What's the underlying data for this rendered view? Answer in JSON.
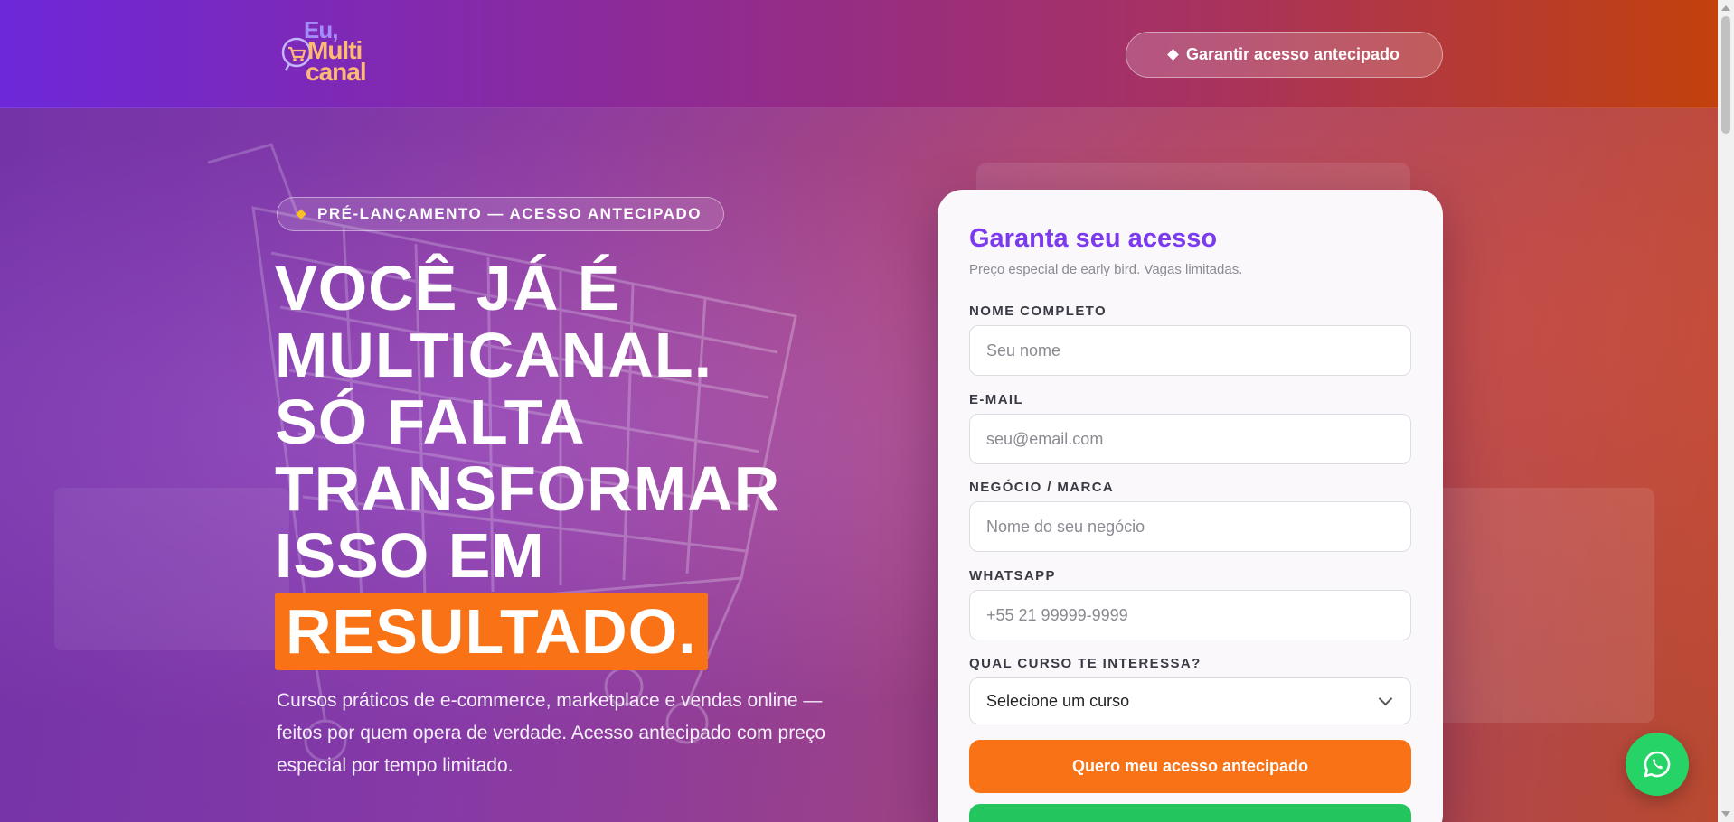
{
  "header": {
    "logo": {
      "line1": "Eu,",
      "line2": "Multi",
      "line3": "canal"
    },
    "cta_label": "Garantir acesso antecipado"
  },
  "hero": {
    "badge": "PRÉ-LANÇAMENTO — ACESSO ANTECIPADO",
    "headline_lines": [
      "VOCÊ JÁ É",
      "MULTICANAL.",
      "SÓ FALTA",
      "TRANSFORMAR",
      "ISSO EM"
    ],
    "headline_highlight": "RESULTADO.",
    "subtext": "Cursos práticos de e-commerce, marketplace e vendas online — feitos por quem opera de verdade. Acesso antecipado com preço especial por tempo limitado."
  },
  "form": {
    "title": "Garanta seu acesso",
    "subtitle": "Preço especial de early bird. Vagas limitadas.",
    "name_label": "NOME COMPLETO",
    "name_placeholder": "Seu nome",
    "email_label": "E-MAIL",
    "email_placeholder": "seu@email.com",
    "business_label": "NEGÓCIO / MARCA",
    "business_placeholder": "Nome do seu negócio",
    "whatsapp_label": "WHATSAPP",
    "whatsapp_placeholder": "+55 21 99999-9999",
    "course_label": "QUAL CURSO TE INTERESSA?",
    "course_selected": "Selecione um curso",
    "submit_label": "Quero meu acesso antecipado"
  },
  "colors": {
    "accent_orange": "#f97316",
    "accent_purple": "#7c3aed",
    "whatsapp_green": "#25d366"
  },
  "icons": [
    "cart-icon",
    "diamond-icon",
    "chevron-down-icon",
    "whatsapp-icon"
  ]
}
